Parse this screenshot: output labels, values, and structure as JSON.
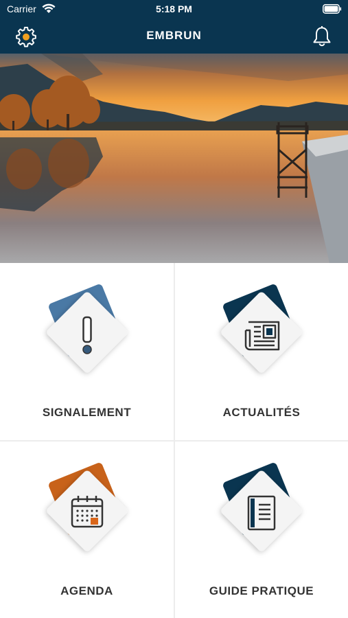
{
  "status_bar": {
    "carrier": "Carrier",
    "time": "5:18 PM"
  },
  "nav": {
    "title": "EMBRUN",
    "settings_icon": "gear-icon",
    "notifications_icon": "bell-icon"
  },
  "hero": {
    "description_icon": "lake-sunset-photo"
  },
  "tiles": [
    {
      "label": "SIGNALEMENT",
      "icon": "exclamation-icon",
      "accent": "#4a79a5"
    },
    {
      "label": "ACTUALITÉS",
      "icon": "newspaper-icon",
      "accent": "#0a3550"
    },
    {
      "label": "AGENDA",
      "icon": "calendar-icon",
      "accent": "#c8621a"
    },
    {
      "label": "GUIDE PRATIQUE",
      "icon": "book-icon",
      "accent": "#0a3550"
    }
  ],
  "colors": {
    "header_bg": "#0a3550",
    "settings_dot": "#f0a020",
    "calendar_marker": "#d9661a"
  }
}
